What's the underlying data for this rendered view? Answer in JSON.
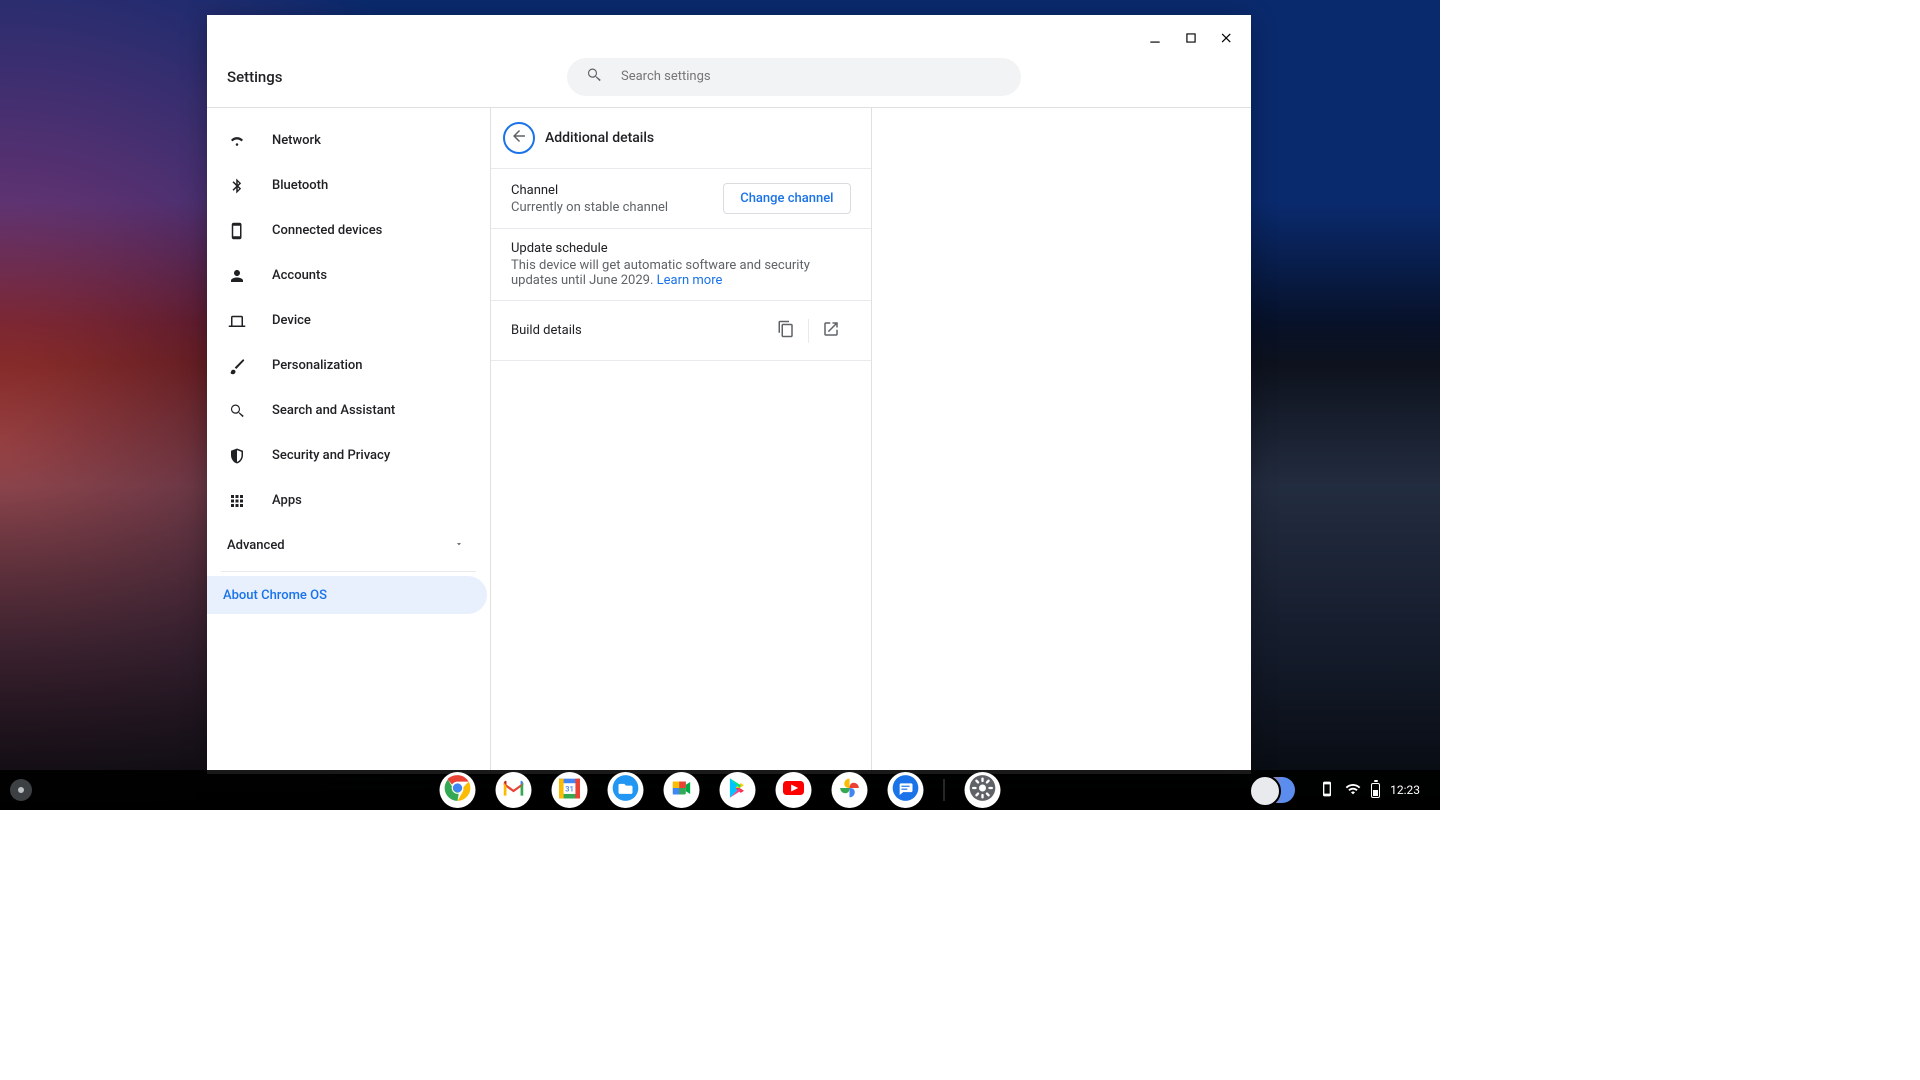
{
  "app": {
    "title": "Settings"
  },
  "search": {
    "placeholder": "Search settings"
  },
  "sidebar": {
    "items": [
      {
        "label": "Network",
        "icon": "wifi"
      },
      {
        "label": "Bluetooth",
        "icon": "bluetooth"
      },
      {
        "label": "Connected devices",
        "icon": "phone"
      },
      {
        "label": "Accounts",
        "icon": "person"
      },
      {
        "label": "Device",
        "icon": "laptop"
      },
      {
        "label": "Personalization",
        "icon": "brush"
      },
      {
        "label": "Search and Assistant",
        "icon": "search"
      },
      {
        "label": "Security and Privacy",
        "icon": "shield"
      },
      {
        "label": "Apps",
        "icon": "apps-grid"
      }
    ],
    "advanced_label": "Advanced",
    "about_label": "About Chrome OS"
  },
  "page": {
    "title": "Additional details",
    "channel": {
      "title": "Channel",
      "subtitle": "Currently on stable channel",
      "button": "Change channel"
    },
    "update": {
      "title": "Update schedule",
      "subtitle_prefix": "This device will get automatic software and security updates until June 2029. ",
      "learn_more": "Learn more"
    },
    "build": {
      "title": "Build details"
    }
  },
  "shelf": {
    "apps": [
      {
        "name": "chrome",
        "type": "chrome"
      },
      {
        "name": "gmail",
        "type": "gmail"
      },
      {
        "name": "calendar",
        "type": "calendar",
        "badge": "31"
      },
      {
        "name": "files",
        "type": "files"
      },
      {
        "name": "meet",
        "type": "meet"
      },
      {
        "name": "play-store",
        "type": "play"
      },
      {
        "name": "youtube",
        "type": "youtube"
      },
      {
        "name": "photos",
        "type": "photos"
      },
      {
        "name": "messages",
        "type": "messages"
      },
      {
        "name": "settings",
        "type": "settings",
        "after_sep": true
      }
    ],
    "clock": "12:23"
  }
}
